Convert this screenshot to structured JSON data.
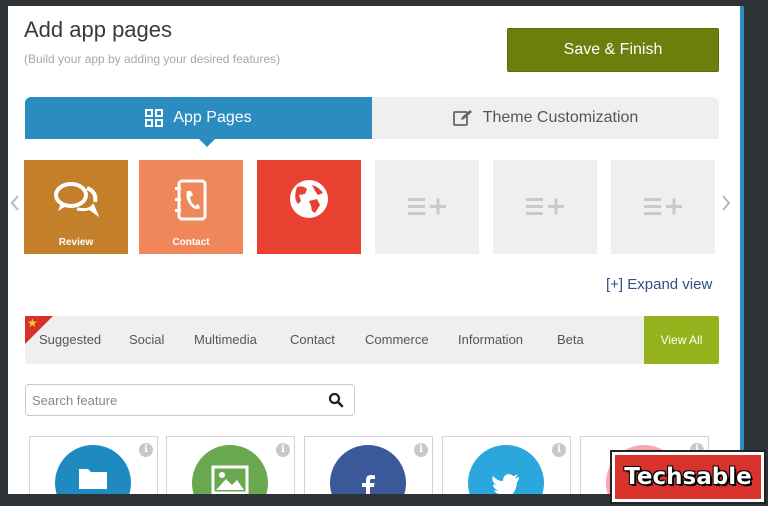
{
  "header": {
    "title": "Add app pages",
    "subtitle": "(Build your app by adding your desired features)",
    "save_label": "Save & Finish"
  },
  "tabs": [
    {
      "label": "App Pages",
      "icon": "grid-icon",
      "active": true
    },
    {
      "label": "Theme Customization",
      "icon": "edit-icon",
      "active": false
    }
  ],
  "pages": [
    {
      "label": "Review",
      "icon": "chat-bubbles-icon",
      "color": "#c47f2b"
    },
    {
      "label": "Contact",
      "icon": "address-book-icon",
      "color": "#f0875b"
    },
    {
      "label": "",
      "icon": "globe-icon",
      "color": "#e84132"
    }
  ],
  "empty_slots": 3,
  "expand_label": "[+] Expand view",
  "categories": [
    {
      "label": "Suggested"
    },
    {
      "label": "Social"
    },
    {
      "label": "Multimedia"
    },
    {
      "label": "Contact"
    },
    {
      "label": "Commerce"
    },
    {
      "label": "Information"
    },
    {
      "label": "Beta"
    }
  ],
  "view_all_label": "View All",
  "search": {
    "placeholder": "Search feature",
    "value": ""
  },
  "features": [
    {
      "icon": "folder-icon",
      "color": "#1f8ac0"
    },
    {
      "icon": "image-icon",
      "color": "#6aa84f"
    },
    {
      "icon": "facebook-icon",
      "color": "#3b5998"
    },
    {
      "icon": "twitter-icon",
      "color": "#2ba7de"
    },
    {
      "icon": "unknown-icon",
      "color": "#f4a6b0"
    }
  ],
  "watermark": "Techsable",
  "colors": {
    "primary_blue": "#2b8cc0",
    "save_green": "#6b7f0c",
    "view_all_green": "#95b11b",
    "watermark_red": "#d9322d"
  }
}
